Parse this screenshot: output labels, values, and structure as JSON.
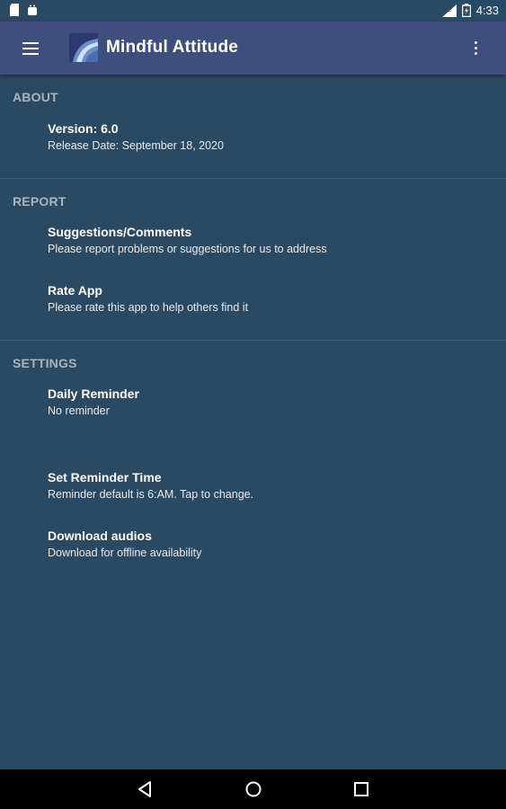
{
  "status_bar": {
    "time": "4:33",
    "icons": [
      "sd-card-icon",
      "android-icon",
      "signal-icon",
      "battery-icon"
    ]
  },
  "app_bar": {
    "title": "Mindful Attitude",
    "background": "#3f4e7c",
    "menu_icon": "hamburger-menu-icon",
    "overflow_icon": "more-vertical-icon"
  },
  "sections": {
    "about": {
      "header": "ABOUT",
      "items": [
        {
          "title": "Version: 6.0",
          "subtitle": "Release Date: September 18, 2020"
        }
      ]
    },
    "report": {
      "header": "REPORT",
      "items": [
        {
          "title": "Suggestions/Comments",
          "subtitle": "Please report problems or suggestions for us to address"
        },
        {
          "title": "Rate App",
          "subtitle": "Please rate this app to help others find it"
        }
      ]
    },
    "settings": {
      "header": "SETTINGS",
      "items": [
        {
          "title": "Daily Reminder",
          "subtitle": "No reminder"
        },
        {
          "title": "Set Reminder Time",
          "subtitle": "Reminder default is 6:AM. Tap to change."
        },
        {
          "title": "Download audios",
          "subtitle": "Download for offline availability"
        }
      ]
    }
  },
  "nav_bar": {
    "icons": [
      "back-icon",
      "home-icon",
      "recents-icon"
    ]
  },
  "colors": {
    "background": "#2a4a63",
    "section_header": "#a7b5c0",
    "divider": "#3e5c74"
  }
}
